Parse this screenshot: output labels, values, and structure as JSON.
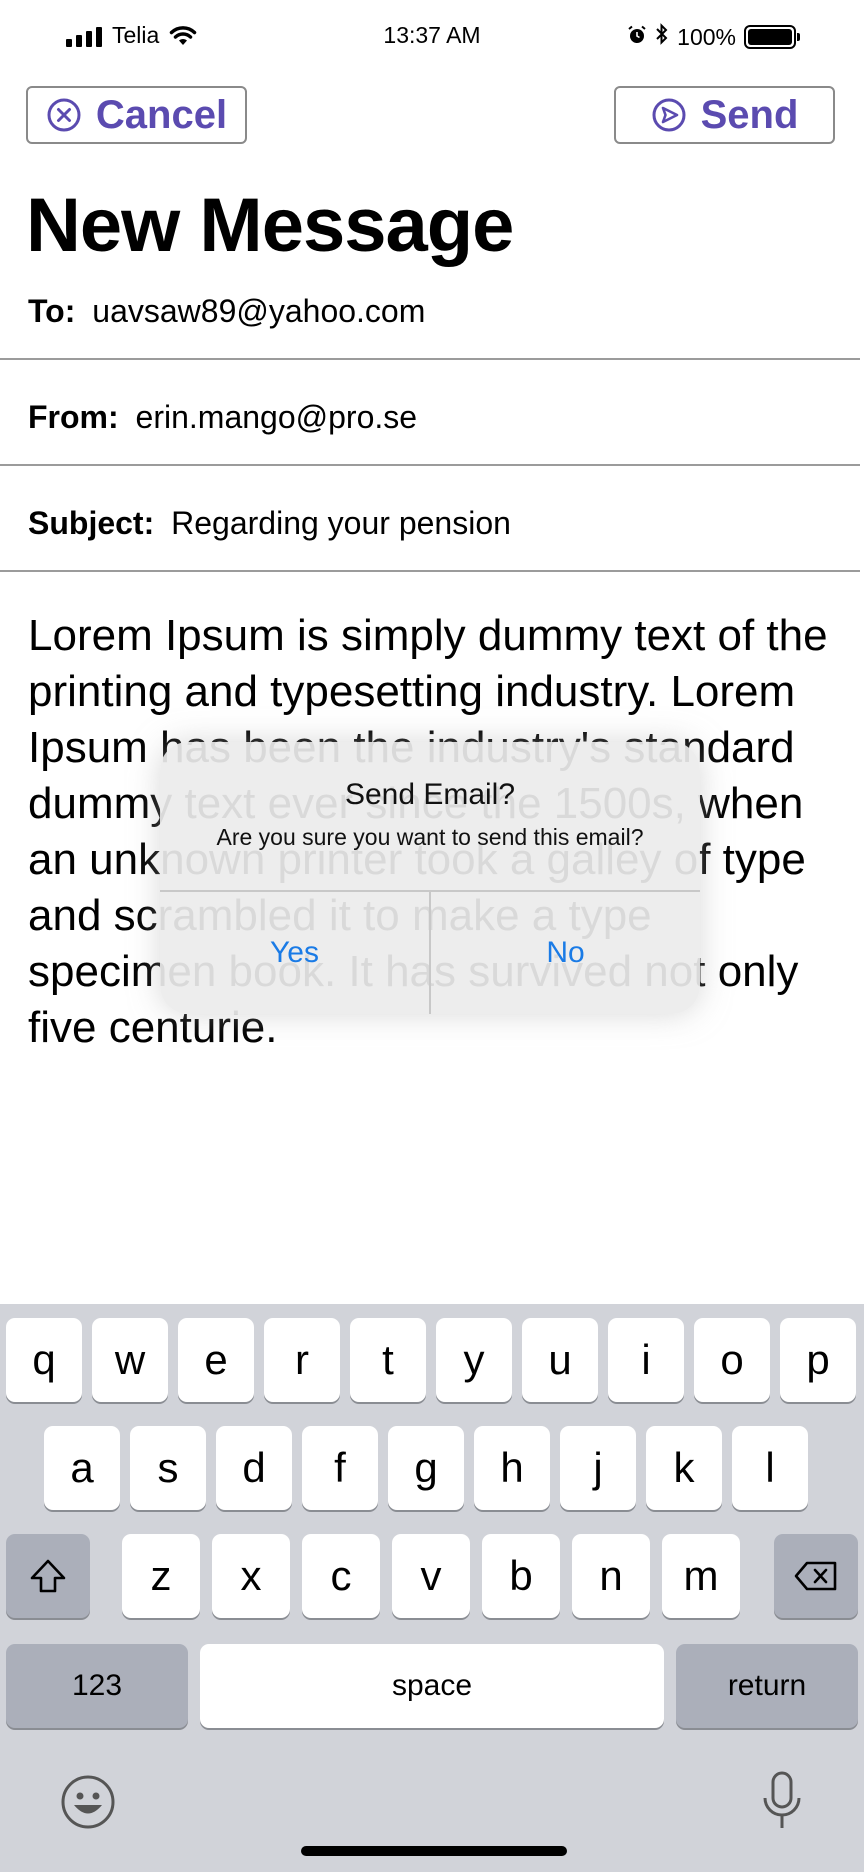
{
  "status_bar": {
    "carrier": "Telia",
    "time": "13:37 AM",
    "battery": "100%",
    "battery_level": 1.0,
    "icons": [
      "signal-icon",
      "wifi-icon",
      "alarm-icon",
      "bluetooth-icon",
      "battery-icon"
    ]
  },
  "toolbar": {
    "cancel_label": "Cancel",
    "send_label": "Send",
    "accent_color": "#5b4bb0"
  },
  "page_title": "New Message",
  "fields": {
    "to_label": "To:",
    "to_value": "uavsaw89@yahoo.com",
    "from_label": "From:",
    "from_value": "erin.mango@pro.se",
    "subject_label": "Subject:",
    "subject_value": "Regarding your pension"
  },
  "body_text": "Lorem Ipsum is simply dummy text of the printing and typesetting industry. Lorem Ipsum has been the industry's standard dummy text ever since the 1500s, when an unknown printer took a galley of type and scrambled it to make a type specimen book. It has survived not only five centurie.",
  "dialog": {
    "title": "Send Email?",
    "message": "Are you sure you want to send this email?",
    "yes_label": "Yes",
    "no_label": "No",
    "button_color": "#1a7be6"
  },
  "keyboard": {
    "row1": [
      "q",
      "w",
      "e",
      "r",
      "t",
      "y",
      "u",
      "i",
      "o",
      "p"
    ],
    "row2": [
      "a",
      "s",
      "d",
      "f",
      "g",
      "h",
      "j",
      "k",
      "l"
    ],
    "row3": [
      "z",
      "x",
      "c",
      "v",
      "b",
      "n",
      "m"
    ],
    "numbers_label": "123",
    "space_label": "space",
    "return_label": "return"
  }
}
